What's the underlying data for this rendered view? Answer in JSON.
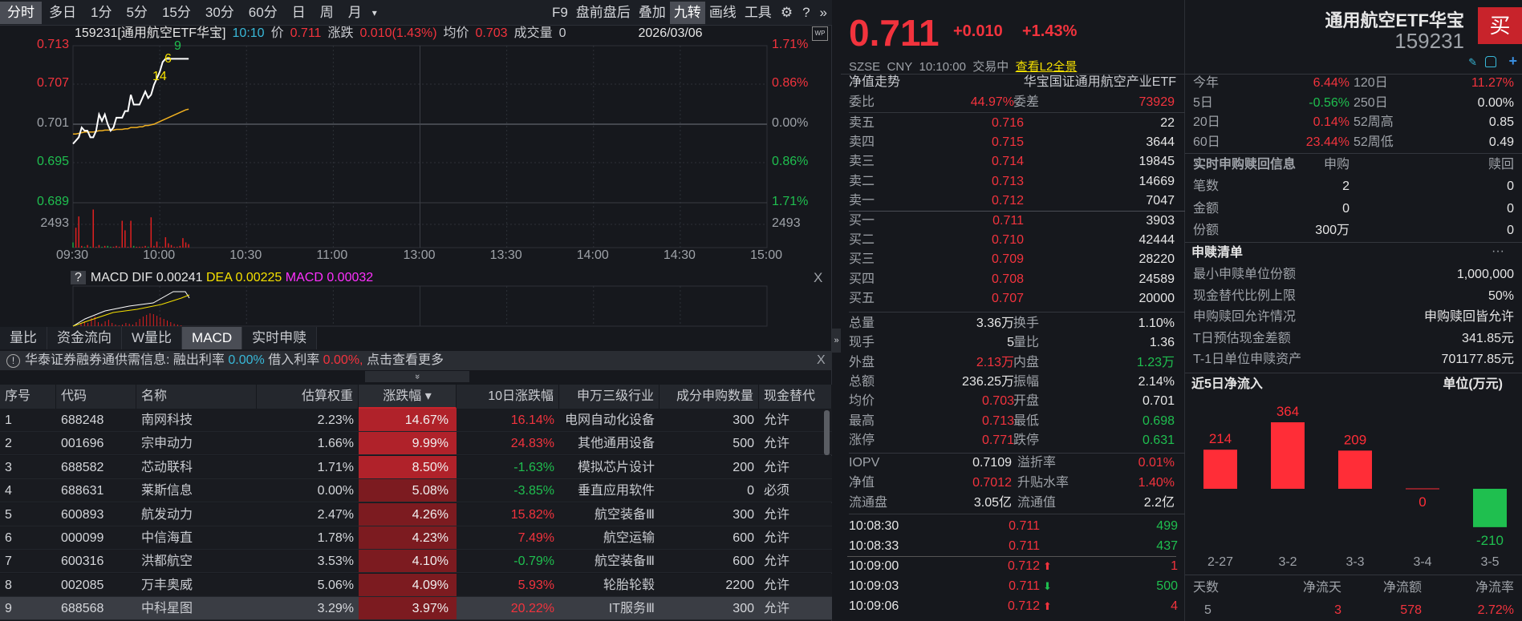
{
  "toolbar": {
    "left": [
      "分时",
      "多日",
      "1分",
      "5分",
      "15分",
      "30分",
      "60分",
      "日",
      "周",
      "月"
    ],
    "more": "▾",
    "right": [
      "F9",
      "盘前盘后",
      "叠加",
      "九转",
      "画线",
      "工具"
    ],
    "active_left": 0,
    "active_right": 3
  },
  "info": {
    "code_name": "159231[通用航空ETF华宝]",
    "time": "10:10",
    "price_label": "价",
    "price": "0.711",
    "change_label": "涨跌",
    "change": "0.010(1.43%)",
    "avg_label": "均价",
    "avg": "0.703",
    "volume_label": "成交量",
    "volume": "0",
    "date": "2026/03/06",
    "wp": "WP"
  },
  "chart": {
    "left_axis": [
      "0.713",
      "0.707",
      "0.701",
      "0.695",
      "0.689"
    ],
    "right_axis": [
      "1.71%",
      "0.86%",
      "0.00%",
      "0.86%",
      "1.71%"
    ],
    "vol_axis": "2493",
    "times": [
      "09:30",
      "10:00",
      "10:30",
      "11:00",
      "13:00",
      "13:30",
      "14:00",
      "14:30",
      "15:00"
    ],
    "markers": [
      "9",
      "6",
      "14"
    ],
    "price": [
      0.698,
      0.6985,
      0.699,
      0.7005,
      0.7,
      0.7,
      0.699,
      0.699,
      0.7,
      0.7025,
      0.7015,
      0.7025,
      0.701,
      0.7,
      0.7005,
      0.702,
      0.702,
      0.702,
      0.703,
      0.703,
      0.7055,
      0.704,
      0.704,
      0.704,
      0.705,
      0.706,
      0.705,
      0.7055,
      0.707,
      0.708,
      0.709,
      0.7105,
      0.711,
      0.711,
      0.711,
      0.711,
      0.711,
      0.711,
      0.711,
      0.711,
      0.711
    ],
    "avg": [
      0.6995,
      0.6995,
      0.6996,
      0.6997,
      0.6998,
      0.6998,
      0.6998,
      0.6998,
      0.6999,
      0.7,
      0.7,
      0.7001,
      0.7001,
      0.7001,
      0.7001,
      0.7002,
      0.7002,
      0.7002,
      0.7003,
      0.7003,
      0.7005,
      0.7005,
      0.7005,
      0.7006,
      0.7006,
      0.7008,
      0.7008,
      0.7009,
      0.701,
      0.7012,
      0.7014,
      0.7016,
      0.7018,
      0.702,
      0.7022,
      0.7024,
      0.7026,
      0.7028,
      0.703,
      0.7032,
      0.7033
    ],
    "volume": [
      600,
      2300,
      3600,
      200,
      100,
      300,
      100,
      4400,
      100,
      300,
      100,
      200,
      200,
      100,
      100,
      200,
      100,
      3100,
      2000,
      100,
      3100,
      200,
      100,
      100,
      100,
      200,
      100,
      3500,
      200,
      700,
      100,
      100,
      1200,
      500,
      300,
      100,
      100,
      200,
      1100,
      600,
      400
    ]
  },
  "macd": {
    "help": "?",
    "label": "MACD",
    "dif_label": "DIF",
    "dif": "0.00241",
    "dea_label": "DEA",
    "dea": "0.00225",
    "macd_label": "MACD",
    "macd": "0.00032",
    "close": "X"
  },
  "tabs": [
    "量比",
    "资金流向",
    "W量比",
    "MACD",
    "实时申赎"
  ],
  "active_tab": 3,
  "notice": {
    "text": "华泰证券融券通供需信息:",
    "rate1_label": "融出利率",
    "rate1": "0.00%",
    "rate2_label": "借入利率",
    "rate2": "0.00%,",
    "more": "点击查看更多",
    "close": "X",
    "expand": "»"
  },
  "table": {
    "headers": [
      "序号",
      "代码",
      "名称",
      "估算权重",
      "涨跌幅 ▾",
      "10日涨跌幅",
      "申万三级行业",
      "成分申购数量",
      "现金替代"
    ],
    "rows": [
      [
        "1",
        "688248",
        "南网科技",
        "2.23%",
        "14.67%",
        "16.14%",
        "电网自动化设备",
        "300",
        "允许"
      ],
      [
        "2",
        "001696",
        "宗申动力",
        "1.66%",
        "9.99%",
        "24.83%",
        "其他通用设备",
        "500",
        "允许"
      ],
      [
        "3",
        "688582",
        "芯动联科",
        "1.71%",
        "8.50%",
        "-1.63%",
        "模拟芯片设计",
        "200",
        "允许"
      ],
      [
        "4",
        "688631",
        "莱斯信息",
        "0.00%",
        "5.08%",
        "-3.85%",
        "垂直应用软件",
        "0",
        "必须"
      ],
      [
        "5",
        "600893",
        "航发动力",
        "2.47%",
        "4.26%",
        "15.82%",
        "航空装备Ⅲ",
        "300",
        "允许"
      ],
      [
        "6",
        "000099",
        "中信海直",
        "1.78%",
        "4.23%",
        "7.49%",
        "航空运输",
        "600",
        "允许"
      ],
      [
        "7",
        "600316",
        "洪都航空",
        "3.53%",
        "4.10%",
        "-0.79%",
        "航空装备Ⅲ",
        "600",
        "允许"
      ],
      [
        "8",
        "002085",
        "万丰奥威",
        "5.06%",
        "4.09%",
        "5.93%",
        "轮胎轮毂",
        "2200",
        "允许"
      ],
      [
        "9",
        "688568",
        "中科星图",
        "3.29%",
        "3.97%",
        "20.22%",
        "IT服务Ⅲ",
        "300",
        "允许"
      ]
    ]
  },
  "quote": {
    "price": "0.711",
    "change": "+0.010",
    "pct": "+1.43%",
    "name": "通用航空ETF华宝",
    "code": "159231",
    "buy": "买",
    "market": "SZSE",
    "currency": "CNY",
    "time": "10:10:00",
    "status": "交易中",
    "l2": "查看L2全景",
    "nav_trend": "净值走势",
    "fund_name": "华宝国证通用航空产业ETF"
  },
  "book": {
    "wb_label": "委比",
    "wb": "44.97%",
    "wc_label": "委差",
    "wc": "73929",
    "asks": [
      [
        "卖五",
        "0.716",
        "22"
      ],
      [
        "卖四",
        "0.715",
        "3644"
      ],
      [
        "卖三",
        "0.714",
        "19845"
      ],
      [
        "卖二",
        "0.713",
        "14669"
      ],
      [
        "卖一",
        "0.712",
        "7047"
      ]
    ],
    "bids": [
      [
        "买一",
        "0.711",
        "3903"
      ],
      [
        "买二",
        "0.710",
        "42444"
      ],
      [
        "买三",
        "0.709",
        "28220"
      ],
      [
        "买四",
        "0.708",
        "24589"
      ],
      [
        "买五",
        "0.707",
        "20000"
      ]
    ]
  },
  "stats": [
    [
      "总量",
      "3.36万",
      "white",
      "换手",
      "1.10%",
      "white"
    ],
    [
      "现手",
      "5",
      "white",
      "量比",
      "1.36",
      "white"
    ],
    [
      "外盘",
      "2.13万",
      "red",
      "内盘",
      "1.23万",
      "green"
    ],
    [
      "总额",
      "236.25万",
      "white",
      "振幅",
      "2.14%",
      "white"
    ],
    [
      "均价",
      "0.703",
      "red",
      "开盘",
      "0.701",
      "white"
    ],
    [
      "最高",
      "0.713",
      "red",
      "最低",
      "0.698",
      "green"
    ],
    [
      "涨停",
      "0.771",
      "red",
      "跌停",
      "0.631",
      "green"
    ]
  ],
  "etf_stats": [
    [
      "IOPV",
      "0.7109",
      "white",
      "溢折率",
      "0.01%",
      "red"
    ],
    [
      "净值",
      "0.7012",
      "red",
      "升贴水率",
      "1.40%",
      "red"
    ],
    [
      "流通盘",
      "3.05亿",
      "white",
      "流通值",
      "2.2亿",
      "white"
    ]
  ],
  "ticks": [
    [
      "10:08:30",
      "0.711",
      "",
      "499",
      "green"
    ],
    [
      "10:08:33",
      "0.711",
      "",
      "437",
      "green"
    ],
    [
      "10:09:00",
      "0.712",
      "up",
      "1",
      "red"
    ],
    [
      "10:09:03",
      "0.711",
      "down",
      "500",
      "green"
    ],
    [
      "10:09:06",
      "0.712",
      "up",
      "4",
      "red"
    ]
  ],
  "perf": [
    [
      "今年",
      "6.44%",
      "red",
      "120日",
      "11.27%",
      "red"
    ],
    [
      "5日",
      "-0.56%",
      "green",
      "250日",
      "0.00%",
      "white"
    ],
    [
      "20日",
      "0.14%",
      "red",
      "52周高",
      "0.85",
      "white"
    ],
    [
      "60日",
      "23.44%",
      "red",
      "52周低",
      "0.49",
      "white"
    ]
  ],
  "realtime": {
    "title": "实时申购赎回信息",
    "sub": "申购",
    "red": "赎回",
    "rows": [
      [
        "笔数",
        "2",
        "0"
      ],
      [
        "金额",
        "0",
        "0"
      ],
      [
        "份额",
        "300万",
        "0"
      ]
    ]
  },
  "creation": {
    "title": "申赎清单",
    "more": "···",
    "rows": [
      [
        "最小申赎单位份额",
        "1,000,000"
      ],
      [
        "现金替代比例上限",
        "50%"
      ],
      [
        "申购赎回允许情况",
        "申购赎回皆允许"
      ],
      [
        "T日预估现金差额",
        "341.85元"
      ],
      [
        "T-1日单位申赎资产",
        "701177.85元"
      ]
    ]
  },
  "flow": {
    "title": "近5日净流入",
    "unit": "单位(万元)",
    "dates": [
      "2-27",
      "3-2",
      "3-3",
      "3-4",
      "3-5"
    ],
    "values": [
      214,
      364,
      209,
      0,
      -210
    ],
    "labels": [
      "214",
      "364",
      "209",
      "0",
      "-210"
    ],
    "summary_headers": [
      "天数",
      "净流天",
      "净流额",
      "净流率"
    ],
    "summary_values": [
      "5",
      "3",
      "578",
      "2.72%"
    ]
  },
  "colors": {
    "red": "#f2333d",
    "green": "#1fbf4f",
    "bg": "#16181d"
  }
}
